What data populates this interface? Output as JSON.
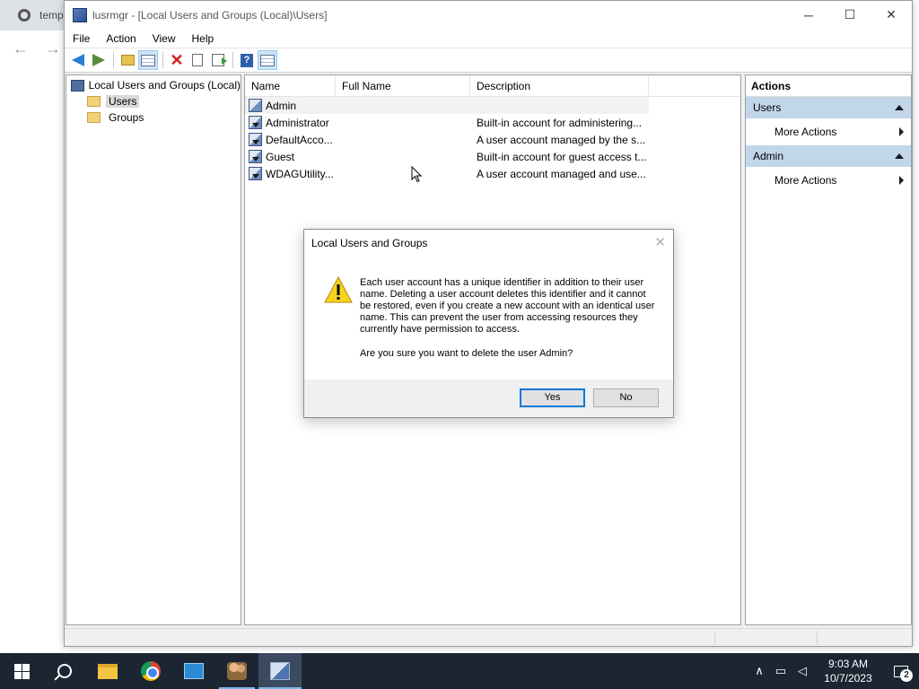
{
  "background_browser": {
    "tab_label": "temp",
    "back_glyph": "←",
    "forward_glyph": "→"
  },
  "window": {
    "title": "lusrmgr - [Local Users and Groups (Local)\\Users]",
    "minimize_glyph": "─",
    "maximize_glyph": "☐",
    "close_glyph": "✕"
  },
  "menu": [
    "File",
    "Action",
    "View",
    "Help"
  ],
  "toolbar": {
    "icons": [
      "back-icon",
      "forward-icon",
      "up-folder-icon",
      "show-hide-tree-icon",
      "delete-icon",
      "properties-icon",
      "export-list-icon",
      "help-icon",
      "show-hide-action-pane-icon"
    ]
  },
  "tree": {
    "root": "Local Users and Groups (Local)",
    "children": [
      "Users",
      "Groups"
    ],
    "selected": "Users"
  },
  "list": {
    "columns": [
      "Name",
      "Full Name",
      "Description"
    ],
    "rows": [
      {
        "name": "Admin",
        "full_name": "",
        "description": ""
      },
      {
        "name": "Administrator",
        "full_name": "",
        "description": "Built-in account for administering..."
      },
      {
        "name": "DefaultAcco...",
        "full_name": "",
        "description": "A user account managed by the s..."
      },
      {
        "name": "Guest",
        "full_name": "",
        "description": "Built-in account for guest access t..."
      },
      {
        "name": "WDAGUtility...",
        "full_name": "",
        "description": "A user account managed and use..."
      }
    ]
  },
  "actions": {
    "title": "Actions",
    "sections": [
      {
        "header": "Users",
        "item": "More Actions"
      },
      {
        "header": "Admin",
        "item": "More Actions"
      }
    ]
  },
  "dialog": {
    "title": "Local Users and Groups",
    "close_glyph": "✕",
    "message": "Each user account has a unique identifier in addition to their user name. Deleting a user account deletes this identifier and it cannot be restored, even if you create a new account with an identical user name. This can prevent the user from accessing resources they currently have permission to access.",
    "question": "Are you sure you want to delete the user Admin?",
    "yes_label": "Yes",
    "no_label": "No"
  },
  "taskbar": {
    "time": "9:03 AM",
    "date": "10/7/2023",
    "notification_count": "2",
    "apps": [
      "start-icon",
      "search-icon",
      "file-explorer-icon",
      "chrome-icon",
      "control-panel-icon",
      "users-icon",
      "mmc-icon"
    ]
  }
}
